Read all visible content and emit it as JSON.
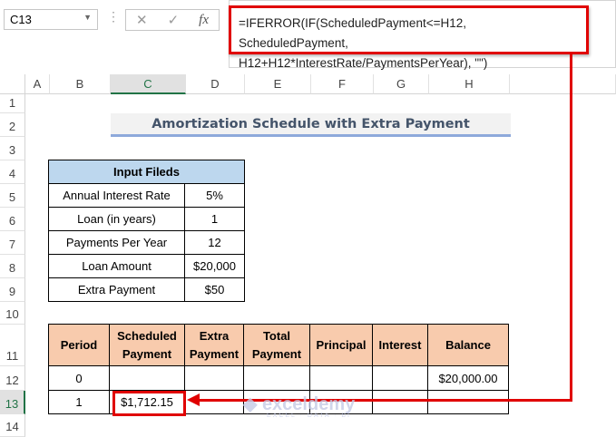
{
  "name_box": {
    "value": "C13"
  },
  "formula_bar": {
    "cancel_icon": "✕",
    "enter_icon": "✓",
    "fx_label": "fx",
    "line1": "=IFERROR(IF(ScheduledPayment<=H12, ScheduledPayment,",
    "line2": "H12+H12*InterestRate/PaymentsPerYear), \"\")"
  },
  "columns": [
    "A",
    "B",
    "C",
    "D",
    "E",
    "F",
    "G",
    "H"
  ],
  "rows": [
    "1",
    "2",
    "3",
    "4",
    "5",
    "6",
    "7",
    "8",
    "9",
    "10",
    "11",
    "12",
    "13",
    "14"
  ],
  "title": "Amortization Schedule with Extra Payment",
  "inputs": {
    "header": "Input Fileds",
    "items": [
      {
        "label": "Annual Interest Rate",
        "value": "5%"
      },
      {
        "label": "Loan (in years)",
        "value": "1"
      },
      {
        "label": "Payments Per Year",
        "value": "12"
      },
      {
        "label": "Loan Amount",
        "value": "$20,000"
      },
      {
        "label": "Extra Payment",
        "value": "$50"
      }
    ]
  },
  "schedule": {
    "headers": [
      "Period",
      "Scheduled Payment",
      "Extra Payment",
      "Total Payment",
      "Principal",
      "Interest",
      "Balance"
    ],
    "rows": [
      [
        "0",
        "",
        "",
        "",
        "",
        "",
        "$20,000.00"
      ],
      [
        "1",
        "$1,712.15",
        "",
        "",
        "",
        "",
        ""
      ]
    ]
  },
  "watermark": {
    "name": "exceldemy",
    "tagline": "EXCEL · DATA · BI"
  },
  "colors": {
    "highlight": "#e00000",
    "input_header": "#bdd7ee",
    "schedule_header": "#f8cbad"
  }
}
